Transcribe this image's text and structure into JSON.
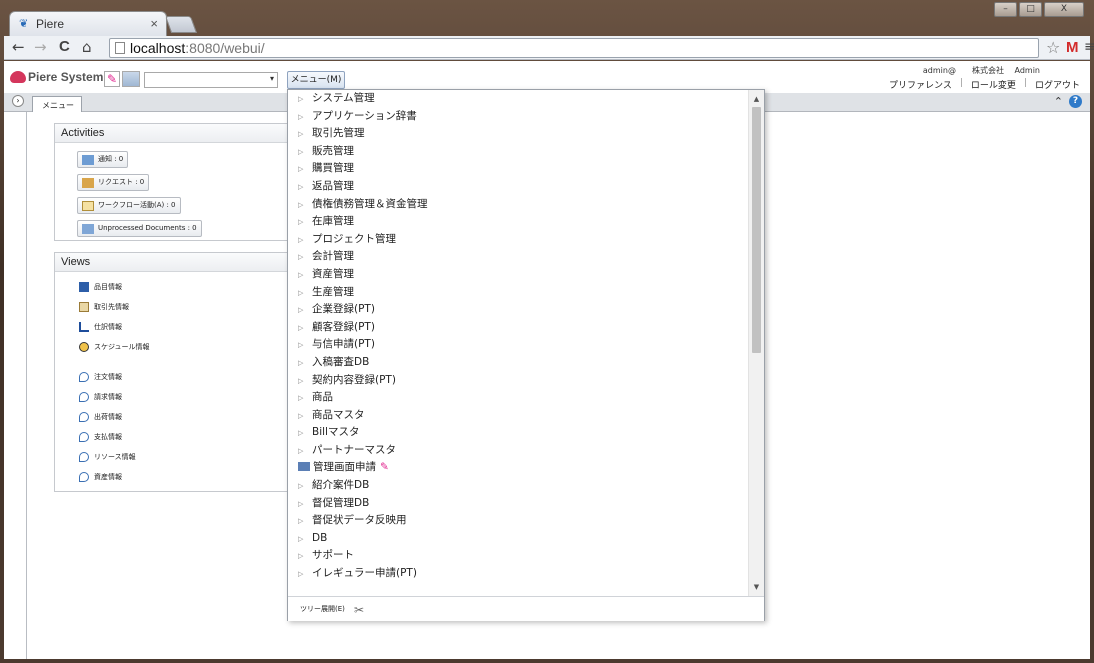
{
  "browser": {
    "tab_title": "Piere",
    "tab_close": "×",
    "url_host": "localhost",
    "url_rest": ":8080/webui/",
    "back": "←",
    "forward": "→",
    "reload": "C",
    "home": "⌂",
    "star": "☆",
    "gmail": "M",
    "menu": "≡",
    "win_min": "–",
    "win_max": "□",
    "win_close": "X"
  },
  "app": {
    "logo_text": "Piere System",
    "menu_button": "メニュー(M)",
    "combo_arrow": "▾",
    "user_info": "admin@　　株式会社 　Admin",
    "links": [
      "プリファレンス",
      "ロール変更",
      "ログアウト"
    ],
    "menu_tab": "メニュー",
    "help": "?",
    "collapse": "›",
    "up": "⌃"
  },
  "activities": {
    "title": "Activities",
    "buttons": [
      "通知 : 0",
      "リクエスト : 0",
      "ワークフロー活動(A) : 0",
      "Unprocessed Documents : 0"
    ]
  },
  "views": {
    "title": "Views",
    "items": [
      "品目情報",
      "取引先情報",
      "仕訳情報",
      "スケジュール情報",
      "注文情報",
      "請求情報",
      "出荷情報",
      "支払情報",
      "リソース情報",
      "資産情報"
    ]
  },
  "dropdown": {
    "items": [
      "システム管理",
      "アプリケーション辞書",
      "取引先管理",
      "販売管理",
      "購買管理",
      "返品管理",
      "債権債務管理＆資金管理",
      "在庫管理",
      "プロジェクト管理",
      "会計管理",
      "資産管理",
      "生産管理",
      "企業登録(PT)",
      "顧客登録(PT)",
      "与信申請(PT)",
      "入稿審査DB",
      "契約内容登録(PT)",
      "商品",
      "商品マスタ",
      "Billマスタ",
      "パートナーマスタ",
      "管理画面申請",
      "紹介案件DB",
      "督促管理DB",
      "督促状データ反映用",
      "DB",
      "サポート",
      "イレギュラー申請(PT)"
    ],
    "footer_label": "ツリー展開(E)",
    "scroll_up": "▲",
    "scroll_down": "▼"
  },
  "colors": {
    "accent_pink": "#e0208c",
    "logo_red": "#d4365c",
    "help_blue": "#2f7ac9"
  }
}
